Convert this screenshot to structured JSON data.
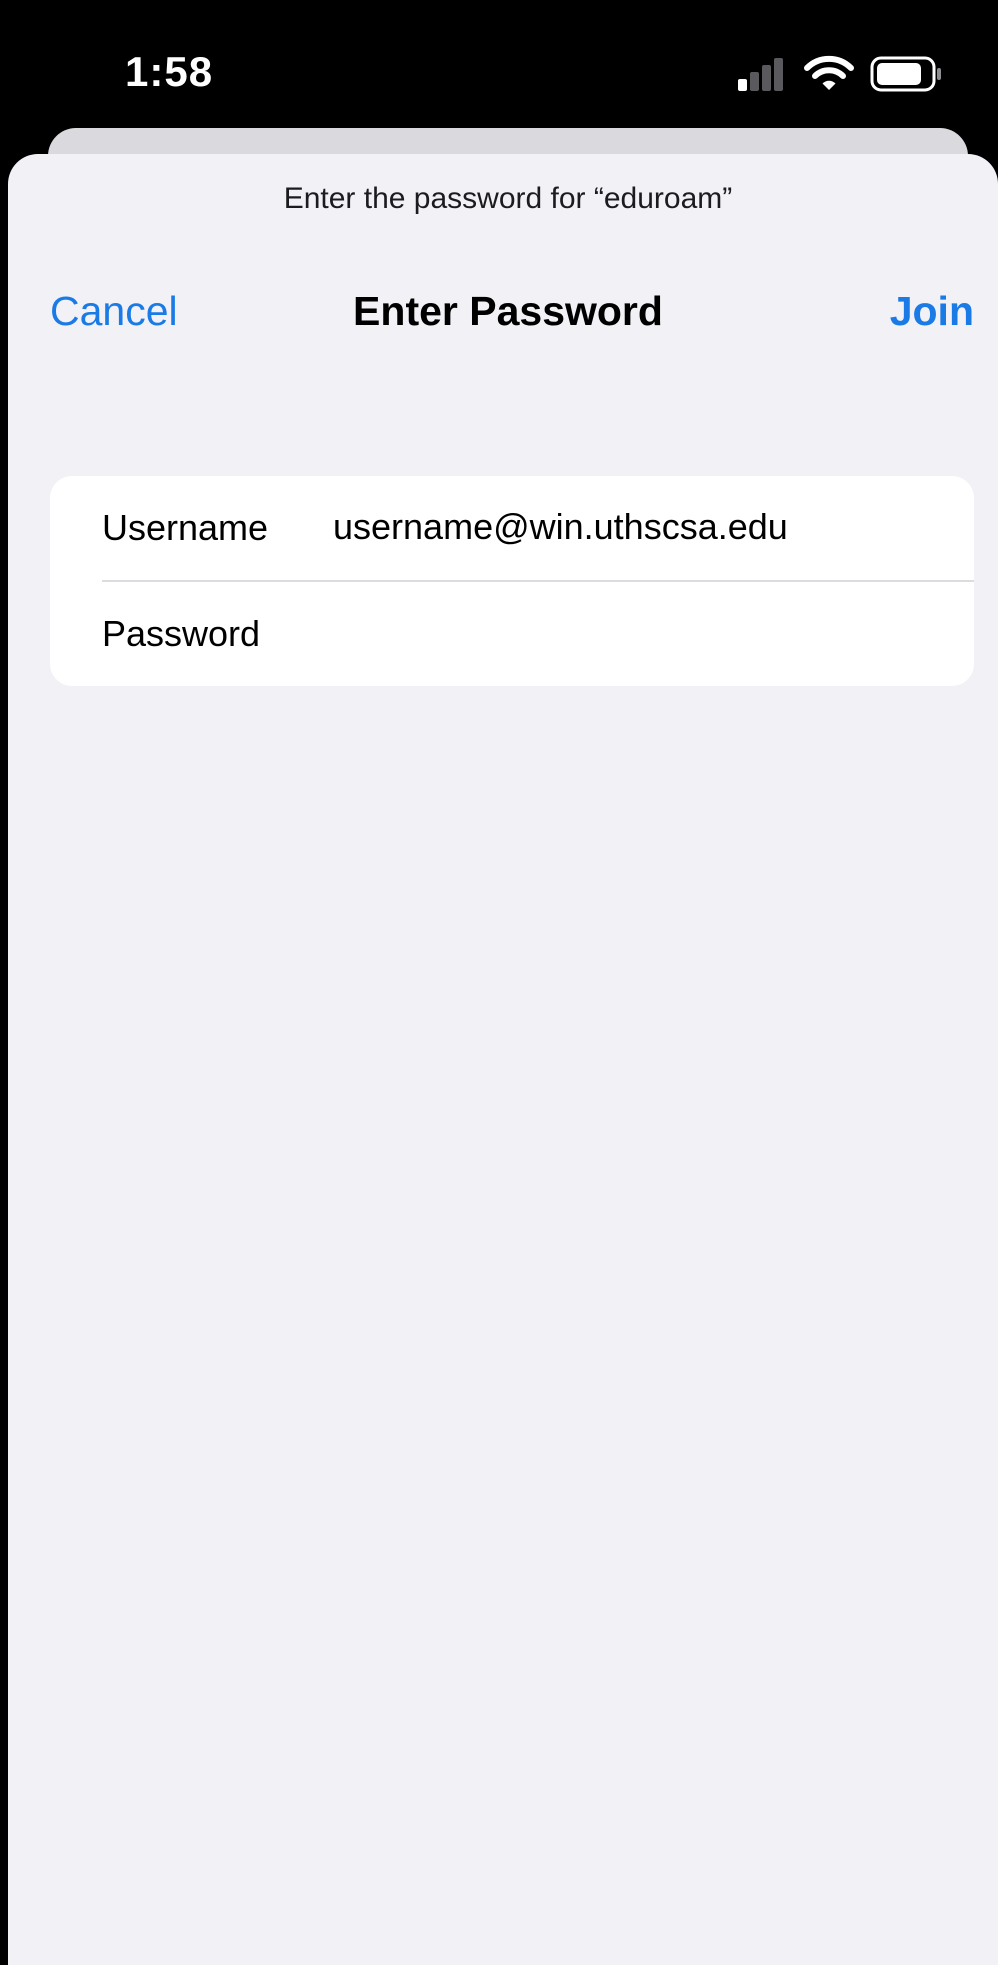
{
  "status_bar": {
    "time": "1:58",
    "icons": [
      "cellular-signal-icon",
      "wifi-icon",
      "battery-icon"
    ]
  },
  "sheet": {
    "prompt": "Enter the password for “eduroam”",
    "nav": {
      "cancel_label": "Cancel",
      "title": "Enter Password",
      "join_label": "Join"
    },
    "form": {
      "username_label": "Username",
      "username_value": "username@win.uthscsa.edu",
      "password_label": "Password",
      "password_value": ""
    }
  },
  "colors": {
    "accent": "#1a7ae6",
    "sheet_background": "#f1f1f6",
    "card_background": "#ffffff",
    "status_bar_background": "#000000"
  }
}
